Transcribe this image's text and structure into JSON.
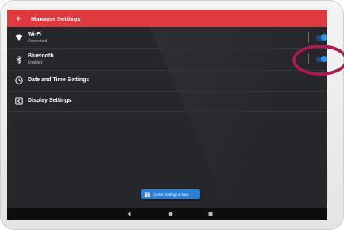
{
  "appbar": {
    "title": "Manager Settings",
    "color": "#e03a3e"
  },
  "settings": [
    {
      "id": "wifi",
      "title": "Wi-Fi",
      "subtitle": "Connected",
      "icon": "wifi-icon",
      "toggle": true,
      "enabled": true
    },
    {
      "id": "bluetooth",
      "title": "Bluetooth",
      "subtitle": "Enabled",
      "icon": "bluetooth-icon",
      "toggle": true,
      "enabled": true
    },
    {
      "id": "datetime",
      "title": "Date and Time Settings",
      "icon": "clock-icon",
      "toggle": false
    },
    {
      "id": "display",
      "title": "Display Settings",
      "icon": "display-icon",
      "toggle": false
    }
  ],
  "confirm_button": {
    "label": "Confirm Settings & Save",
    "icon": "save-icon",
    "color": "#2b7fd4"
  },
  "navbar": {
    "buttons": [
      "back-icon",
      "home-icon",
      "recents-icon"
    ]
  },
  "annotation": {
    "highlight_color": "#b0194f"
  },
  "theme": {
    "background": "#25272b",
    "toggle_on": "#2a93e8"
  }
}
